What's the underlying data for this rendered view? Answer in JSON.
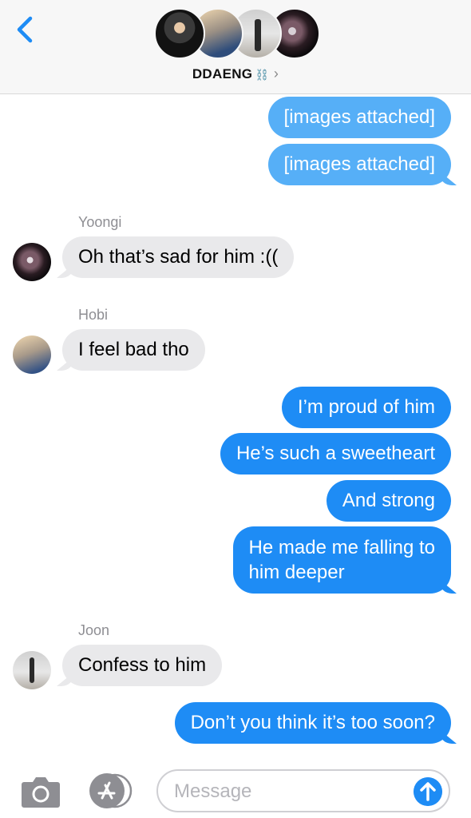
{
  "header": {
    "group_name": "DDAENG",
    "name_decoration": "⛓️",
    "chevron": "›",
    "colors": {
      "header_bg": "#f7f7f7",
      "back_blue": "#1e8cf5"
    }
  },
  "messages": [
    {
      "type": "outgoing",
      "text": "[images attached]"
    },
    {
      "type": "outgoing",
      "text": "[images attached]"
    },
    {
      "type": "incoming",
      "sender": "Yoongi",
      "text": "Oh that’s sad for him :(("
    },
    {
      "type": "incoming",
      "sender": "Hobi",
      "text": "I feel bad tho"
    },
    {
      "type": "outgoing",
      "text": "I’m proud of him"
    },
    {
      "type": "outgoing",
      "text": "He’s such a sweetheart"
    },
    {
      "type": "outgoing",
      "text": "And strong"
    },
    {
      "type": "outgoing",
      "lines": [
        "He made me falling to",
        "him deeper"
      ]
    },
    {
      "type": "incoming",
      "sender": "Joon",
      "text": "Confess to him"
    },
    {
      "type": "outgoing",
      "text": "Don’t you think it’s too soon?"
    }
  ],
  "input": {
    "placeholder": "Message",
    "icons": [
      "camera-icon",
      "app-store-icon",
      "send-arrow-icon"
    ]
  },
  "colors": {
    "outgoing": "#1e8cf5",
    "outgoing_attachment": "#56aff7",
    "incoming": "#e9e9eb"
  }
}
